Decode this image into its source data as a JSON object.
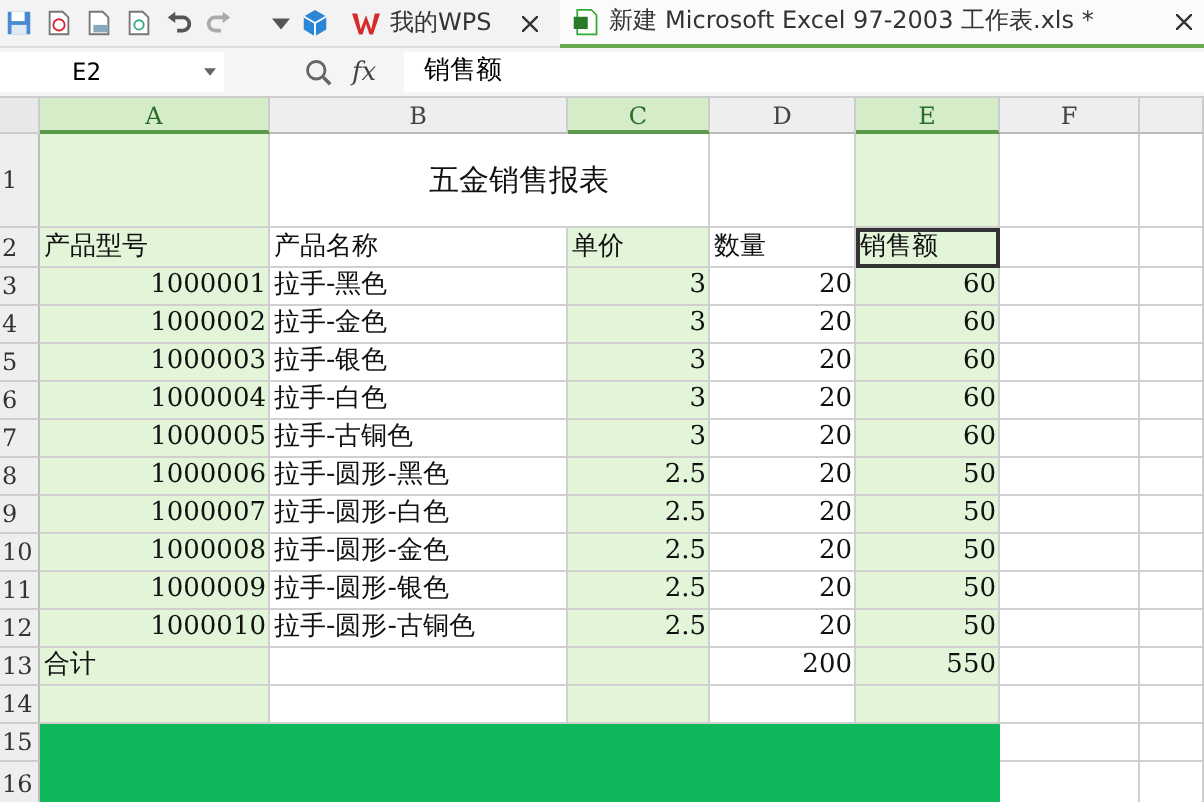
{
  "tabs": [
    {
      "label": "我的WPS",
      "kind": "home",
      "selected": false
    },
    {
      "label": "新建 Microsoft Excel 97-2003 工作表.xls *",
      "kind": "sheet",
      "selected": true
    }
  ],
  "formula_bar": {
    "cell_ref": "E2",
    "fx": "fx",
    "value": "销售额"
  },
  "columns": [
    {
      "label": "A",
      "selected": true
    },
    {
      "label": "B",
      "selected": false
    },
    {
      "label": "C",
      "selected": true
    },
    {
      "label": "D",
      "selected": false
    },
    {
      "label": "E",
      "selected": true
    },
    {
      "label": "F",
      "selected": false
    }
  ],
  "rows": [
    {
      "number": "1",
      "kind": "data",
      "cells": [
        {
          "kind": "blank",
          "selected": false
        },
        {
          "kind": "title",
          "text": "五金销售报表",
          "selected": false
        },
        {
          "kind": "blank",
          "selected": false
        },
        {
          "kind": "blank",
          "selected": false
        },
        {
          "kind": "blank",
          "selected": false
        }
      ]
    },
    {
      "number": "2",
      "kind": "data",
      "cells": [
        {
          "kind": "text",
          "text": "产品型号",
          "selected": false
        },
        {
          "kind": "text",
          "text": "产品名称",
          "selected": false
        },
        {
          "kind": "text",
          "text": "单价",
          "selected": false
        },
        {
          "kind": "text",
          "text": "数量",
          "selected": false
        },
        {
          "kind": "text",
          "text": "销售额",
          "selected": true
        },
        {
          "kind": "blank",
          "selected": false
        }
      ]
    },
    {
      "number": "3",
      "kind": "data",
      "cells": [
        {
          "kind": "number",
          "text": "1000001",
          "selected": false
        },
        {
          "kind": "text",
          "text": "拉手-黑色",
          "selected": false
        },
        {
          "kind": "number",
          "text": "3",
          "selected": false
        },
        {
          "kind": "number",
          "text": "20",
          "selected": false
        },
        {
          "kind": "number",
          "text": "60",
          "selected": false
        },
        {
          "kind": "blank",
          "selected": false
        }
      ]
    },
    {
      "number": "4",
      "kind": "data",
      "cells": [
        {
          "kind": "number",
          "text": "1000002",
          "selected": false
        },
        {
          "kind": "text",
          "text": "拉手-金色",
          "selected": false
        },
        {
          "kind": "number",
          "text": "3",
          "selected": false
        },
        {
          "kind": "number",
          "text": "20",
          "selected": false
        },
        {
          "kind": "number",
          "text": "60",
          "selected": false
        },
        {
          "kind": "blank",
          "selected": false
        }
      ]
    },
    {
      "number": "5",
      "kind": "data",
      "cells": [
        {
          "kind": "number",
          "text": "1000003",
          "selected": false
        },
        {
          "kind": "text",
          "text": "拉手-银色",
          "selected": false
        },
        {
          "kind": "number",
          "text": "3",
          "selected": false
        },
        {
          "kind": "number",
          "text": "20",
          "selected": false
        },
        {
          "kind": "number",
          "text": "60",
          "selected": false
        },
        {
          "kind": "blank",
          "selected": false
        }
      ]
    },
    {
      "number": "6",
      "kind": "data",
      "cells": [
        {
          "kind": "number",
          "text": "1000004",
          "selected": false
        },
        {
          "kind": "text",
          "text": "拉手-白色",
          "selected": false
        },
        {
          "kind": "number",
          "text": "3",
          "selected": false
        },
        {
          "kind": "number",
          "text": "20",
          "selected": false
        },
        {
          "kind": "number",
          "text": "60",
          "selected": false
        },
        {
          "kind": "blank",
          "selected": false
        }
      ]
    },
    {
      "number": "7",
      "kind": "data",
      "cells": [
        {
          "kind": "number",
          "text": "1000005",
          "selected": false
        },
        {
          "kind": "text",
          "text": "拉手-古铜色",
          "selected": false
        },
        {
          "kind": "number",
          "text": "3",
          "selected": false
        },
        {
          "kind": "number",
          "text": "20",
          "selected": false
        },
        {
          "kind": "number",
          "text": "60",
          "selected": false
        },
        {
          "kind": "blank",
          "selected": false
        }
      ]
    },
    {
      "number": "8",
      "kind": "data",
      "cells": [
        {
          "kind": "number",
          "text": "1000006",
          "selected": false
        },
        {
          "kind": "text",
          "text": "拉手-圆形-黑色",
          "selected": false
        },
        {
          "kind": "number",
          "text": "2.5",
          "selected": false
        },
        {
          "kind": "number",
          "text": "20",
          "selected": false
        },
        {
          "kind": "number",
          "text": "50",
          "selected": false
        },
        {
          "kind": "blank",
          "selected": false
        }
      ]
    },
    {
      "number": "9",
      "kind": "data",
      "cells": [
        {
          "kind": "number",
          "text": "1000007",
          "selected": false
        },
        {
          "kind": "text",
          "text": "拉手-圆形-白色",
          "selected": false
        },
        {
          "kind": "number",
          "text": "2.5",
          "selected": false
        },
        {
          "kind": "number",
          "text": "20",
          "selected": false
        },
        {
          "kind": "number",
          "text": "50",
          "selected": false
        },
        {
          "kind": "blank",
          "selected": false
        }
      ]
    },
    {
      "number": "10",
      "kind": "data",
      "cells": [
        {
          "kind": "number",
          "text": "1000008",
          "selected": false
        },
        {
          "kind": "text",
          "text": "拉手-圆形-金色",
          "selected": false
        },
        {
          "kind": "number",
          "text": "2.5",
          "selected": false
        },
        {
          "kind": "number",
          "text": "20",
          "selected": false
        },
        {
          "kind": "number",
          "text": "50",
          "selected": false
        },
        {
          "kind": "blank",
          "selected": false
        }
      ]
    },
    {
      "number": "11",
      "kind": "data",
      "cells": [
        {
          "kind": "number",
          "text": "1000009",
          "selected": false
        },
        {
          "kind": "text",
          "text": "拉手-圆形-银色",
          "selected": false
        },
        {
          "kind": "number",
          "text": "2.5",
          "selected": false
        },
        {
          "kind": "number",
          "text": "20",
          "selected": false
        },
        {
          "kind": "number",
          "text": "50",
          "selected": false
        },
        {
          "kind": "blank",
          "selected": false
        }
      ]
    },
    {
      "number": "12",
      "kind": "data",
      "cells": [
        {
          "kind": "number",
          "text": "1000010",
          "selected": false
        },
        {
          "kind": "text",
          "text": "拉手-圆形-古铜色",
          "selected": false
        },
        {
          "kind": "number",
          "text": "2.5",
          "selected": false
        },
        {
          "kind": "number",
          "text": "20",
          "selected": false
        },
        {
          "kind": "number",
          "text": "50",
          "selected": false
        },
        {
          "kind": "blank",
          "selected": false
        }
      ]
    },
    {
      "number": "13",
      "kind": "data",
      "cells": [
        {
          "kind": "text",
          "text": "合计",
          "selected": false
        },
        {
          "kind": "blank",
          "selected": false
        },
        {
          "kind": "blank",
          "selected": false
        },
        {
          "kind": "number",
          "text": "200",
          "selected": false
        },
        {
          "kind": "number",
          "text": "550",
          "selected": false
        },
        {
          "kind": "blank",
          "selected": false
        }
      ]
    },
    {
      "number": "14",
      "kind": "data",
      "cells": [
        {
          "kind": "blank",
          "selected": false
        },
        {
          "kind": "blank",
          "selected": false
        },
        {
          "kind": "blank",
          "selected": false
        },
        {
          "kind": "blank",
          "selected": false
        },
        {
          "kind": "blank",
          "selected": false
        },
        {
          "kind": "blank",
          "selected": false
        }
      ]
    },
    {
      "number": "15",
      "kind": "banner",
      "cells": [
        {
          "kind": "blank",
          "selected": false
        }
      ]
    },
    {
      "number": "16",
      "kind": "banner",
      "cells": [
        {
          "kind": "blank",
          "selected": false
        }
      ]
    }
  ]
}
